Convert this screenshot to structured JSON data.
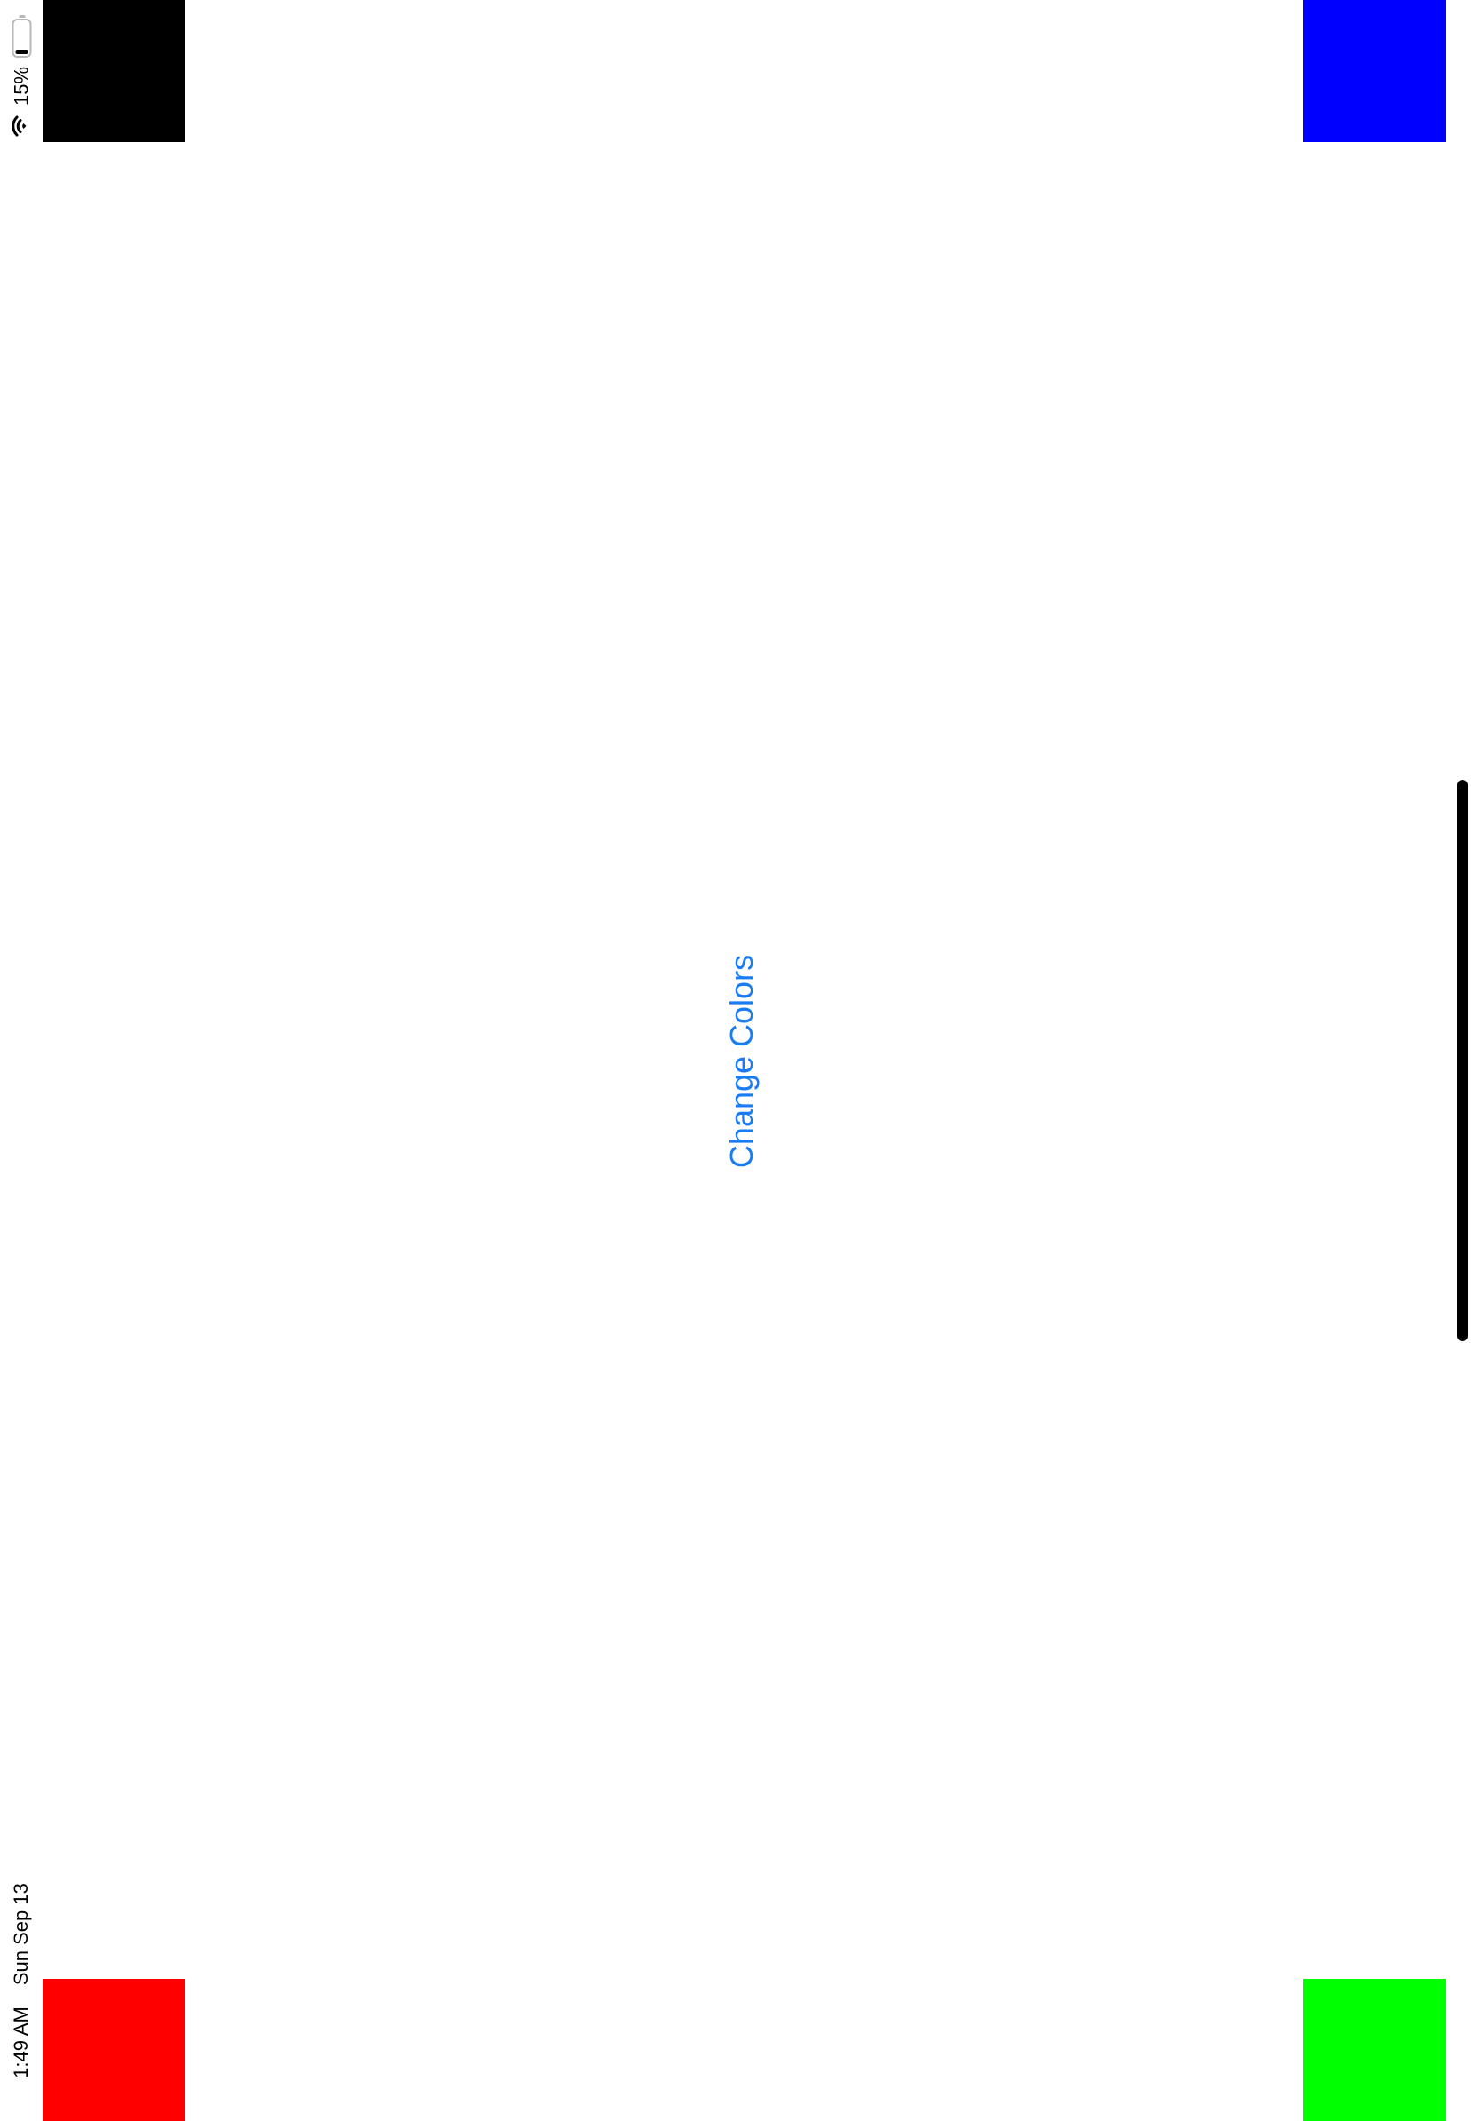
{
  "status_bar": {
    "battery_percent_text": "15%",
    "battery_level": 0.15,
    "time": "1:49 AM",
    "date": "Sun Sep 13",
    "wifi_icon": "wifi-icon",
    "battery_icon": "battery-icon"
  },
  "main": {
    "button_label": "Change Colors",
    "button_color": "#1a7cf3"
  },
  "corner_squares": {
    "top_left_color": "#000000",
    "top_right_color": "#0000ff",
    "bottom_left_color": "#ff0000",
    "bottom_right_color": "#00ff00"
  }
}
